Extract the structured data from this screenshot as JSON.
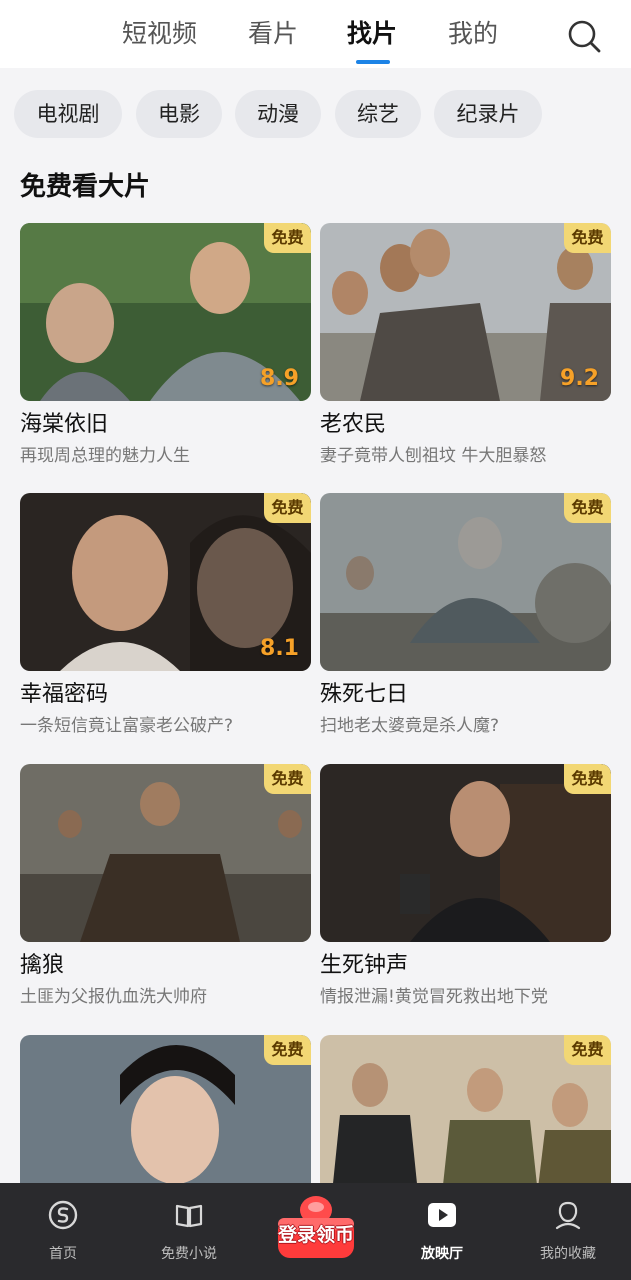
{
  "top_tabs": [
    {
      "label": "短视频",
      "active": false
    },
    {
      "label": "看片",
      "active": false
    },
    {
      "label": "找片",
      "active": true
    },
    {
      "label": "我的",
      "active": false
    }
  ],
  "search_icon": "search-icon",
  "categories": [
    "电视剧",
    "电影",
    "动漫",
    "综艺",
    "纪录片"
  ],
  "section_title": "免费看大片",
  "badge_label": "免费",
  "cards": [
    {
      "title": "海棠依旧",
      "desc": "再现周总理的魅力人生",
      "score": "8.9"
    },
    {
      "title": "老农民",
      "desc": "妻子竟带人刨祖坟 牛大胆暴怒",
      "score": "9.2"
    },
    {
      "title": "幸福密码",
      "desc": "一条短信竟让富豪老公破产?",
      "score": "8.1"
    },
    {
      "title": "殊死七日",
      "desc": "扫地老太婆竟是杀人魔?",
      "score": ""
    },
    {
      "title": "擒狼",
      "desc": "土匪为父报仇血洗大帅府",
      "score": ""
    },
    {
      "title": "生死钟声",
      "desc": "情报泄漏!黄觉冒死救出地下党",
      "score": ""
    },
    {
      "title": "",
      "desc": "",
      "score": ""
    },
    {
      "title": "",
      "desc": "",
      "score": ""
    }
  ],
  "bottom_nav": [
    {
      "label": "首页",
      "icon": "home-icon",
      "active": false
    },
    {
      "label": "免费小说",
      "icon": "book-icon",
      "active": false
    },
    {
      "label": "放映厅",
      "icon": "play-icon",
      "active": true
    },
    {
      "label": "我的收藏",
      "icon": "profile-icon",
      "active": false
    }
  ],
  "login_button": {
    "label": "登录领币"
  },
  "colors": {
    "accent": "#1c83e6",
    "badge": "#f2d774",
    "score": "#f6a128",
    "nav_bg": "#2a2a2d"
  }
}
